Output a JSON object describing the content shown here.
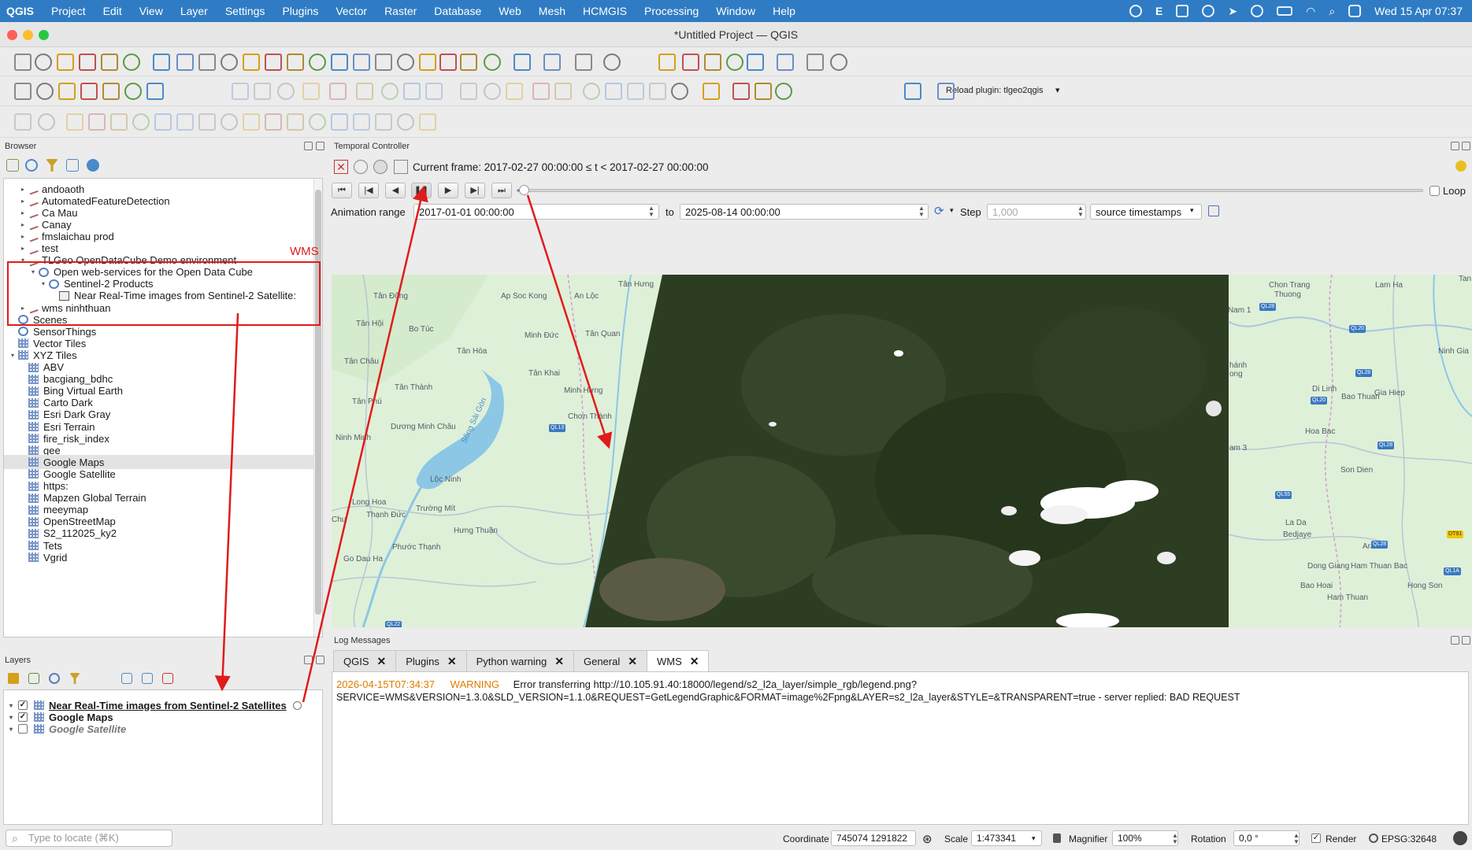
{
  "menubar": {
    "app": "QGIS",
    "items": [
      "Project",
      "Edit",
      "View",
      "Layer",
      "Settings",
      "Plugins",
      "Vector",
      "Raster",
      "Database",
      "Web",
      "Mesh",
      "HCMGIS",
      "Processing",
      "Window",
      "Help"
    ],
    "status_icon_e": "E",
    "clock": "Wed 15 Apr  07:37"
  },
  "window": {
    "title": "*Untitled Project — QGIS"
  },
  "toolbar": {
    "reload_plugin_label": "Reload plugin: tlgeo2qgis"
  },
  "browser": {
    "title": "Browser",
    "items": [
      {
        "label": "andoaoth",
        "icon": "connection-icon",
        "twisty": "▸",
        "indent": 1
      },
      {
        "label": "AutomatedFeatureDetection",
        "icon": "connection-icon",
        "twisty": "▸",
        "indent": 1
      },
      {
        "label": "Ca Mau",
        "icon": "connection-icon",
        "twisty": "▸",
        "indent": 1
      },
      {
        "label": "Canay",
        "icon": "connection-icon",
        "twisty": "▸",
        "indent": 1
      },
      {
        "label": "fmslaichau prod",
        "icon": "connection-icon",
        "twisty": "▸",
        "indent": 1
      },
      {
        "label": "test",
        "icon": "connection-icon",
        "twisty": "▸",
        "indent": 1
      },
      {
        "label": "TLGeo OpenDataCube Demo environment",
        "icon": "connection-icon",
        "twisty": "▾",
        "indent": 1
      },
      {
        "label": "Open web-services for the Open Data Cube",
        "icon": "globe-icon",
        "twisty": "▾",
        "indent": 2
      },
      {
        "label": "Sentinel-2 Products",
        "icon": "globe-icon",
        "twisty": "▾",
        "indent": 3
      },
      {
        "label": "Near Real-Time images from Sentinel-2 Satellite:",
        "icon": "raster-layer-icon",
        "twisty": "",
        "indent": 4
      },
      {
        "label": "wms ninhthuan",
        "icon": "connection-icon",
        "twisty": "▸",
        "indent": 1
      },
      {
        "label": "Scenes",
        "icon": "globe-icon",
        "twisty": "",
        "indent": 0
      },
      {
        "label": "SensorThings",
        "icon": "globe-icon",
        "twisty": "",
        "indent": 0
      },
      {
        "label": "Vector Tiles",
        "icon": "grid-icon",
        "twisty": "",
        "indent": 0
      },
      {
        "label": "XYZ Tiles",
        "icon": "grid-icon",
        "twisty": "▾",
        "indent": 0
      },
      {
        "label": "ABV",
        "icon": "grid-icon",
        "twisty": "",
        "indent": 1
      },
      {
        "label": "bacgiang_bdhc",
        "icon": "grid-icon",
        "twisty": "",
        "indent": 1
      },
      {
        "label": "Bing Virtual Earth",
        "icon": "grid-icon",
        "twisty": "",
        "indent": 1
      },
      {
        "label": "Carto Dark",
        "icon": "grid-icon",
        "twisty": "",
        "indent": 1
      },
      {
        "label": "Esri Dark Gray",
        "icon": "grid-icon",
        "twisty": "",
        "indent": 1
      },
      {
        "label": "Esri Terrain",
        "icon": "grid-icon",
        "twisty": "",
        "indent": 1
      },
      {
        "label": "fire_risk_index",
        "icon": "grid-icon",
        "twisty": "",
        "indent": 1
      },
      {
        "label": "gee",
        "icon": "grid-icon",
        "twisty": "",
        "indent": 1
      },
      {
        "label": "Google Maps",
        "icon": "grid-icon",
        "twisty": "",
        "indent": 1,
        "selected": true
      },
      {
        "label": "Google Satellite",
        "icon": "grid-icon",
        "twisty": "",
        "indent": 1
      },
      {
        "label": "https:",
        "icon": "grid-icon",
        "twisty": "",
        "indent": 1
      },
      {
        "label": "Mapzen Global Terrain",
        "icon": "grid-icon",
        "twisty": "",
        "indent": 1
      },
      {
        "label": "meeymap",
        "icon": "grid-icon",
        "twisty": "",
        "indent": 1
      },
      {
        "label": "OpenStreetMap",
        "icon": "grid-icon",
        "twisty": "",
        "indent": 1
      },
      {
        "label": "S2_112025_ky2",
        "icon": "grid-icon",
        "twisty": "",
        "indent": 1
      },
      {
        "label": "Tets",
        "icon": "grid-icon",
        "twisty": "",
        "indent": 1
      },
      {
        "label": "Vgrid",
        "icon": "grid-icon",
        "twisty": "",
        "indent": 1
      }
    ]
  },
  "annotation": {
    "label": "WMS"
  },
  "layers": {
    "title": "Layers",
    "items": [
      {
        "label": "Near Real-Time images from Sentinel-2 Satellites",
        "checked": true,
        "underline": true,
        "italic": false
      },
      {
        "label": "Google Maps",
        "checked": true,
        "underline": false,
        "italic": false
      },
      {
        "label": "Google Satellite",
        "checked": false,
        "underline": false,
        "italic": true
      }
    ]
  },
  "locate": {
    "placeholder": "Type to locate (⌘K)"
  },
  "temporal": {
    "title": "Temporal Controller",
    "current_frame": "Current frame: 2017-02-27 00:00:00 ≤ t < 2017-02-27 00:00:00",
    "loop_label": "Loop",
    "range_label": "Animation range",
    "range_from": "2017-01-01 00:00:00",
    "to_label": "to",
    "range_to": "2025-08-14 00:00:00",
    "step_label": "Step",
    "step_value": "1,000",
    "step_unit": "source timestamps",
    "slider_position": 0.008
  },
  "map_labels": [
    "Tân Hưng",
    "Tân Đông",
    "Ap Soc Kong",
    "An Lộc",
    "Tân Hội",
    "Bo Túc",
    "Minh Đức",
    "Tân Quan",
    "Tân Hòa",
    "Tân Châu",
    "Tân Khai",
    "Tân Thành",
    "Minh Hưng",
    "Tân Phú",
    "Dương Minh Châu",
    "Chơn Thành",
    "Ninh Minh",
    "Lộc Ninh",
    "Long Hoa",
    "Thạnh Đức",
    "Trường Mít",
    "Hưng Thuận",
    "Chu",
    "Phước Thạnh",
    "Go Dau Ha",
    "Sông Sài Gòn",
    "Chon Trang",
    "Thuong",
    "Lam Ha",
    "Tan Hi",
    "Nam 1",
    "Ninh Gia",
    "hánh",
    "ong",
    "Di Linh",
    "Bao Thuan",
    "Gia Hiep",
    "Hoa Bac",
    "am 3",
    "Son Dien",
    "La Da",
    "Bedjaye",
    "Ara",
    "Dong Giang",
    "Ham Thuan Bac",
    "Hong Son",
    "Bao Hoai",
    "Ham Thuan"
  ],
  "road_shields": [
    "QL13",
    "QL28",
    "QL20",
    "QL28",
    "QL28",
    "QL20",
    "QL55",
    "QL28",
    "DT91",
    "QL1A",
    "QL22"
  ],
  "log": {
    "title": "Log Messages",
    "tabs": [
      "QGIS",
      "Plugins",
      "Python warning",
      "General",
      "WMS"
    ],
    "active_tab": "WMS",
    "timestamp": "2026-04-15T07:34:37",
    "level": "WARNING",
    "line1": "Error transferring http://10.105.91.40:18000/legend/s2_l2a_layer/simple_rgb/legend.png?",
    "line2": "SERVICE=WMS&VERSION=1.3.0&SLD_VERSION=1.1.0&REQUEST=GetLegendGraphic&FORMAT=image%2Fpng&LAYER=s2_l2a_layer&STYLE=&TRANSPARENT=true - server replied: BAD REQUEST"
  },
  "status": {
    "coordinate_label": "Coordinate",
    "coordinate_value": "745074  1291822",
    "scale_label": "Scale",
    "scale_value": "1:473341",
    "magnifier_label": "Magnifier",
    "magnifier_value": "100%",
    "rotation_label": "Rotation",
    "rotation_value": "0,0 °",
    "render_label": "Render",
    "crs": "EPSG:32648"
  },
  "colors": {
    "menubar": "#2f7cc4",
    "annotation": "#e01b1b",
    "warning": "#e07b00",
    "osm_land": "#dff0d8",
    "osm_water": "#8cc7e6",
    "satellite": "#2c3d22"
  }
}
